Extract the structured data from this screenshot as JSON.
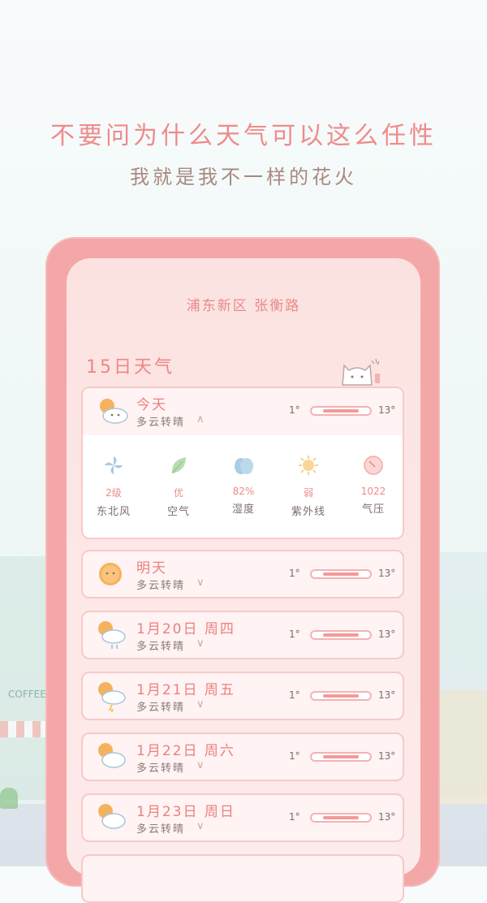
{
  "headline": {
    "line1": "不要问为什么天气可以这么任性",
    "line2": "我就是我不一样的花火"
  },
  "location": "浦东新区 张衡路",
  "section_title": "15日天气",
  "today": {
    "label": "今天",
    "desc": "多云转晴",
    "chevron": "∧",
    "tmin": "1°",
    "tmax": "13°",
    "icon": "sun-cloud-icon",
    "details": [
      {
        "value": "2级",
        "label": "东北风",
        "icon": "wind-pinwheel-icon"
      },
      {
        "value": "优",
        "label": "空气",
        "icon": "leaf-icon"
      },
      {
        "value": "82%",
        "label": "湿度",
        "icon": "water-drop-icon"
      },
      {
        "value": "弱",
        "label": "紫外线",
        "icon": "sun-icon"
      },
      {
        "value": "1022",
        "label": "气压",
        "icon": "pressure-gauge-icon"
      }
    ]
  },
  "days": [
    {
      "label": "明天",
      "desc": "多云转晴",
      "chevron": "∨",
      "tmin": "1°",
      "tmax": "13°",
      "icon": "sun-icon"
    },
    {
      "label": "1月20日 周四",
      "desc": "多云转晴",
      "chevron": "∨",
      "tmin": "1°",
      "tmax": "13°",
      "icon": "sun-cloud-rain-icon"
    },
    {
      "label": "1月21日 周五",
      "desc": "多云转晴",
      "chevron": "∨",
      "tmin": "1°",
      "tmax": "13°",
      "icon": "sun-cloud-storm-icon"
    },
    {
      "label": "1月22日 周六",
      "desc": "多云转晴",
      "chevron": "∨",
      "tmin": "1°",
      "tmax": "13°",
      "icon": "sun-cloud-icon"
    },
    {
      "label": "1月23日 周日",
      "desc": "多云转晴",
      "chevron": "∨",
      "tmin": "1°",
      "tmax": "13°",
      "icon": "sun-cloud-icon"
    }
  ],
  "scene_text": "COFFEE",
  "colors": {
    "accent": "#ef8585",
    "frame": "#f4a7a7",
    "card": "#fff3f3"
  }
}
